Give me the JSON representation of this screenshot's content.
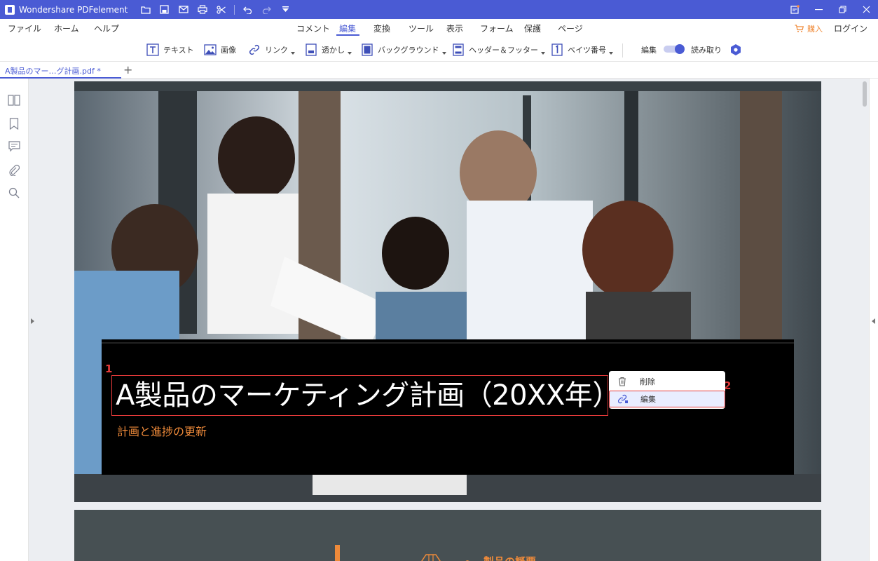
{
  "app": {
    "title": "Wondershare PDFelement"
  },
  "menu": {
    "left": [
      "ファイル",
      "ホーム",
      "ヘルプ"
    ],
    "tabs": [
      "コメント",
      "編集",
      "変換",
      "ツール",
      "表示",
      "フォーム",
      "保護",
      "ページ"
    ],
    "active_tab": "編集",
    "buy": "購入",
    "login": "ログイン"
  },
  "toolbar": {
    "text": "テキスト",
    "image": "画像",
    "link": "リンク",
    "watermark": "透かし",
    "background": "バックグラウンド",
    "header_footer": "ヘッダー＆フッター",
    "bates": "ベイツ番号",
    "mode_edit": "編集",
    "mode_read": "読み取り"
  },
  "document": {
    "tab_name": "A製品のマー…グ計画.pdf *",
    "title": "A製品のマーケティング計画（20XX年）",
    "subtitle": "計画と進捗の更新",
    "page2_heading": "製品の概要"
  },
  "context_menu": {
    "delete": "削除",
    "edit": "編集"
  },
  "markers": {
    "one": "1",
    "two": "2"
  },
  "colors": {
    "brand": "#4a5bd4",
    "accent_orange": "#ee8a3a",
    "highlight_red": "#e53a3a"
  }
}
